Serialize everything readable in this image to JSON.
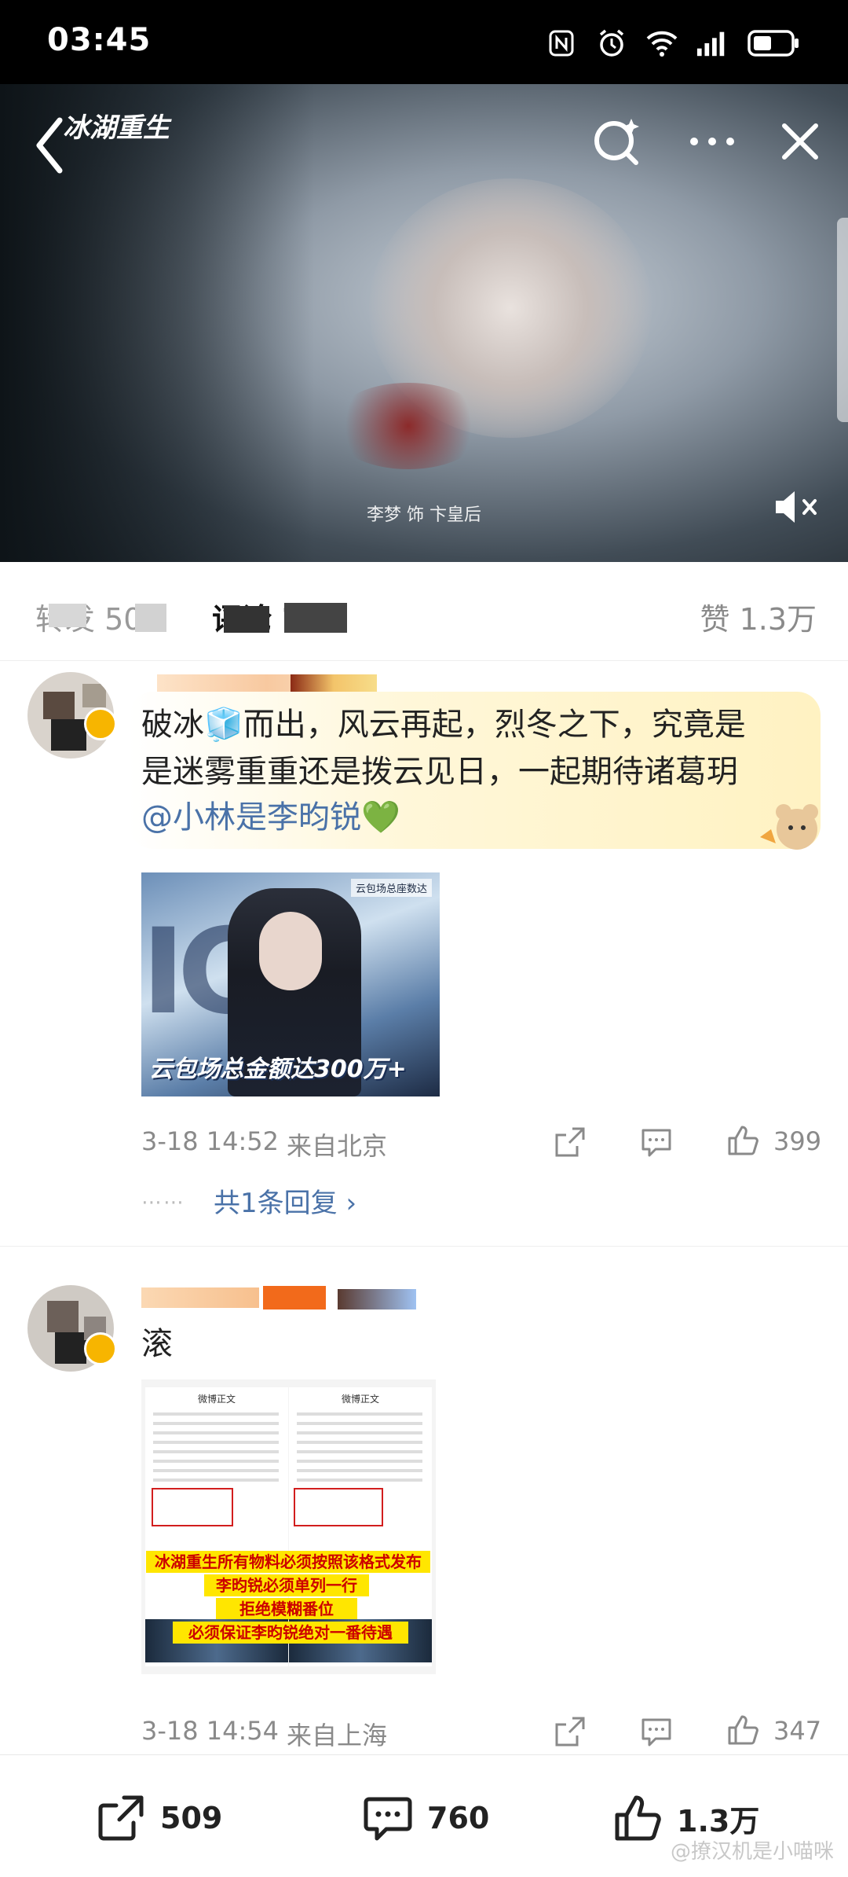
{
  "status_bar": {
    "time": "03:45",
    "icons": [
      "nfc-icon",
      "alarm-icon",
      "wifi-icon",
      "signal-icon",
      "battery-icon"
    ]
  },
  "video": {
    "logo_text": "冰湖重生",
    "caption": "李梦 饰 卞皇后"
  },
  "tabs": {
    "share": "转发 509",
    "comment": "评论 760",
    "like": "赞 1.3万"
  },
  "comments": [
    {
      "text_line1": "破冰🧊而出，风云再起，烈冬之下，究竟是",
      "text_line2": "是迷雾重重还是拨云见日，一起期待诸葛玥",
      "mention": "@小林是李昀锐",
      "heart": "💚",
      "image_banner": "云包场总金额达300万+",
      "image_tag": "云包场总座数达",
      "time": "3-18 14:52",
      "location": "来自北京",
      "likes": "399",
      "replies_link": "共1条回复 ›",
      "replies_dots": "⋯⋯"
    },
    {
      "text": "滚",
      "image_lines": [
        "冰湖重生所有物料必须按照该格式发布",
        "李昀锐必须单列一行",
        "拒绝模糊番位",
        "必须保证李昀锐绝对一番待遇"
      ],
      "image_header": "微博正文",
      "time": "3-18 14:54",
      "location": "来自上海",
      "likes": "347"
    }
  ],
  "bottom_bar": {
    "share_count": "509",
    "comment_count": "760",
    "like_count": "1.3万"
  },
  "watermark": "@撩汉机是小喵咪",
  "colors": {
    "link": "#4a72a8",
    "meta": "#8a8a8a",
    "bubble": "#fff2c2",
    "highlight": "#ffe600"
  }
}
